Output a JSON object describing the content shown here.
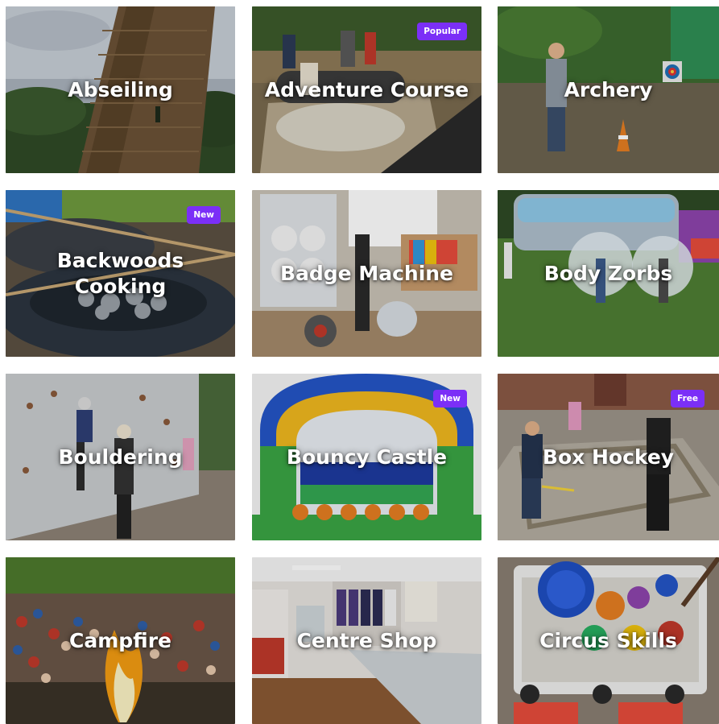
{
  "badge_color": "#7b2ff7",
  "activities": [
    {
      "title": "Abseiling",
      "badge": ""
    },
    {
      "title": "Adventure Course",
      "badge": "Popular"
    },
    {
      "title": "Archery",
      "badge": ""
    },
    {
      "title": "Backwoods Cooking",
      "badge": "New"
    },
    {
      "title": "Badge Machine",
      "badge": ""
    },
    {
      "title": "Body Zorbs",
      "badge": ""
    },
    {
      "title": "Bouldering",
      "badge": ""
    },
    {
      "title": "Bouncy Castle",
      "badge": "New"
    },
    {
      "title": "Box Hockey",
      "badge": "Free"
    },
    {
      "title": "Campfire",
      "badge": ""
    },
    {
      "title": "Centre Shop",
      "badge": ""
    },
    {
      "title": "Circus Skills",
      "badge": ""
    }
  ]
}
